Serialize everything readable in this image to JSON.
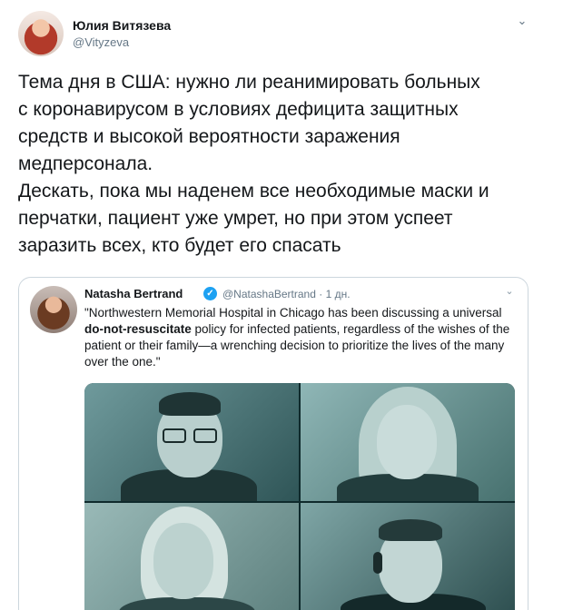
{
  "tweet": {
    "author_name": "Юлия Витязева",
    "author_handle": "@Vityzeva",
    "caret": "⌄",
    "text_lines": [
      "Тема дня в США: нужно ли реанимировать больных",
      "с коронавирусом в условиях дефицита защитных",
      "средств и высокой вероятности заражения",
      "медперсонала.",
      "Дескать, пока мы наденем все необходимые маски и",
      "перчатки, пациент уже умрет, но при этом успеет",
      "заразить всех, кто будет его спасать"
    ]
  },
  "quote": {
    "author_name": "Natasha Bertrand",
    "verified_mark": "✓",
    "handle_time": "@NatashaBertrand · 1 дн.",
    "caret": "⌄",
    "text_part1": "\"Northwestern Memorial Hospital in Chicago has been discussing a universal ",
    "text_bold": "do-not-resuscitate",
    "text_part2": " policy for infected patients, regardless of the wishes of the patient or their family—a wrenching decision to prioritize the lives of the many over the one.\""
  },
  "colors": {
    "text": "#14171a",
    "secondary": "#657786",
    "border": "#ccd6dd",
    "verified": "#1da1f2"
  }
}
